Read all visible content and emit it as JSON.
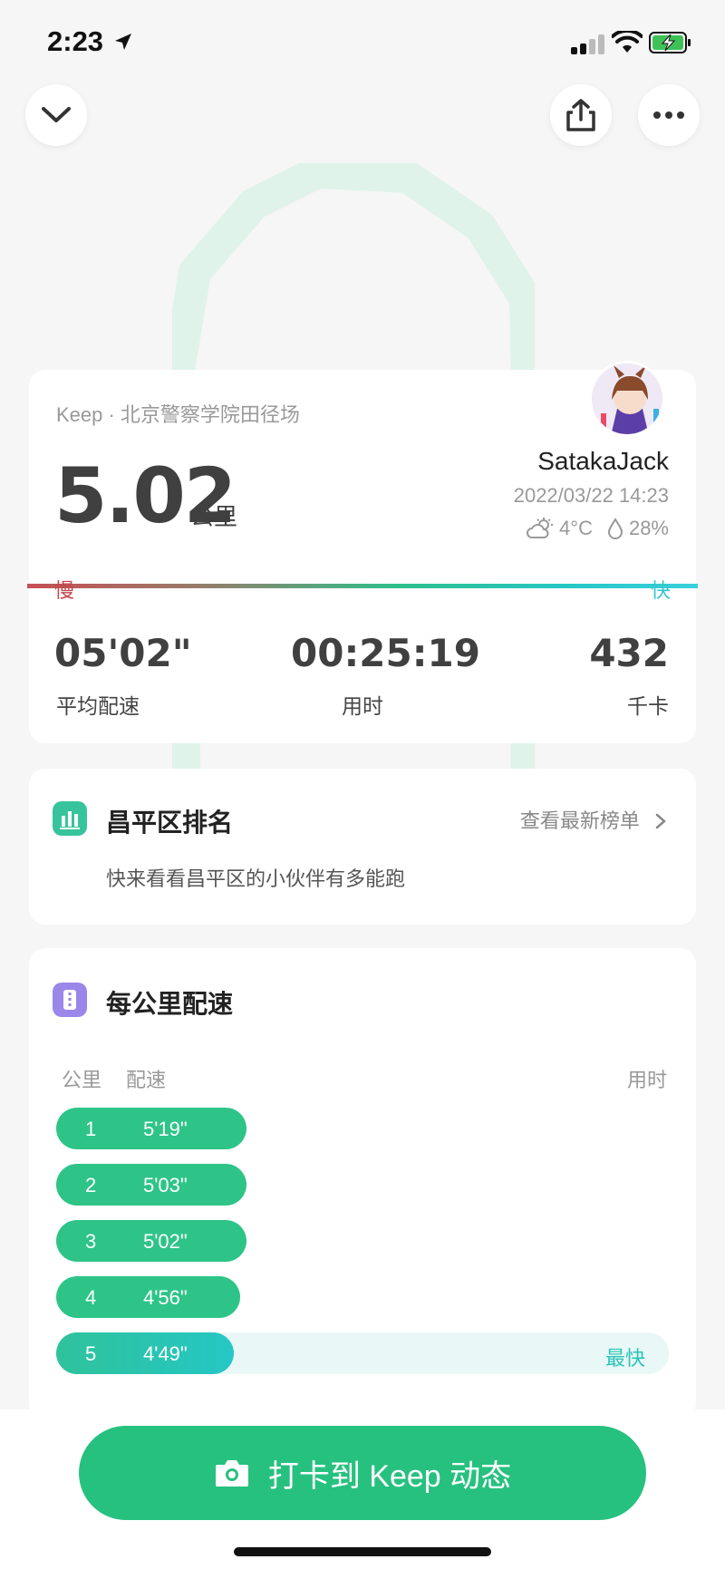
{
  "status_bar": {
    "time": "2:23"
  },
  "summary": {
    "source": "Keep · 北京警察学院田径场",
    "distance": "5.02",
    "distance_unit": "公里",
    "username": "SatakaJack",
    "datetime": "2022/03/22 14:23",
    "temperature": "4°C",
    "humidity": "28%",
    "slow_label": "慢",
    "fast_label": "快",
    "metrics": [
      {
        "value": "05'02\"",
        "label": "平均配速"
      },
      {
        "value": "00:25:19",
        "label": "用时"
      },
      {
        "value": "432",
        "label": "千卡"
      }
    ]
  },
  "rank": {
    "title": "昌平区排名",
    "link": "查看最新榜单",
    "subtitle": "快来看看昌平区的小伙伴有多能跑"
  },
  "pace_card": {
    "title": "每公里配速",
    "headers": {
      "km": "公里",
      "pace": "配速",
      "time": "用时"
    },
    "rows": [
      {
        "km": "1",
        "pace": "5'19\"",
        "fill": 0.31
      },
      {
        "km": "2",
        "pace": "5'03\"",
        "fill": 0.31
      },
      {
        "km": "3",
        "pace": "5'02\"",
        "fill": 0.31
      },
      {
        "km": "4",
        "pace": "4'56\"",
        "fill": 0.3
      },
      {
        "km": "5",
        "pace": "4'49\"",
        "fill": 0.29
      }
    ],
    "fastest_label": "最快"
  },
  "checkin": {
    "label": "打卡到 Keep 动态"
  },
  "colors": {
    "accent": "#27c17f",
    "teal": "#25c7c5",
    "slow": "#c64f55",
    "purple": "#9b86ea"
  }
}
